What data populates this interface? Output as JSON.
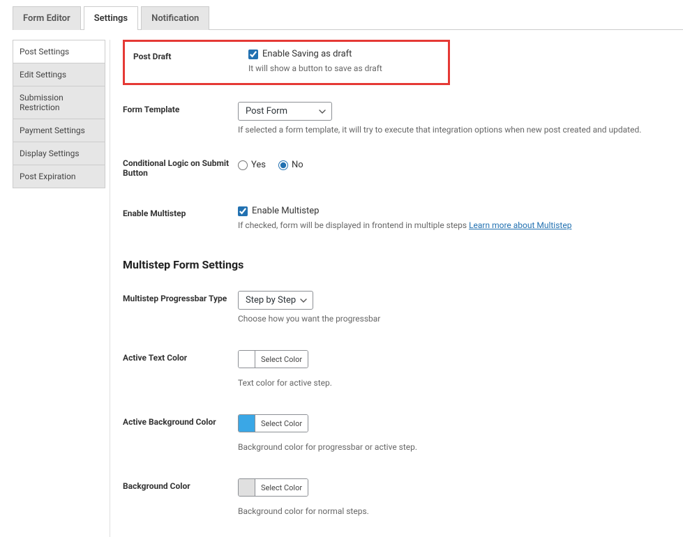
{
  "tabs": {
    "form_editor": "Form Editor",
    "settings": "Settings",
    "notification": "Notification"
  },
  "sidebar": {
    "items": [
      "Post Settings",
      "Edit Settings",
      "Submission Restriction",
      "Payment Settings",
      "Display Settings",
      "Post Expiration"
    ]
  },
  "fields": {
    "post_draft": {
      "label": "Post Draft",
      "chk_label": "Enable Saving as draft",
      "help": "It will show a button to save as draft"
    },
    "form_template": {
      "label": "Form Template",
      "value": "Post Form",
      "help": "If selected a form template, it will try to execute that integration options when new post created and updated."
    },
    "conditional": {
      "label": "Conditional Logic on Submit Button",
      "yes": "Yes",
      "no": "No"
    },
    "multistep": {
      "label": "Enable Multistep",
      "chk_label": "Enable Multistep",
      "help": "If checked, form will be displayed in frontend in multiple steps ",
      "link": "Learn more about Multistep"
    },
    "section_heading": "Multistep Form Settings",
    "progressbar_type": {
      "label": "Multistep Progressbar Type",
      "value": "Step by Step",
      "help": "Choose how you want the progressbar"
    },
    "active_text_color": {
      "label": "Active Text Color",
      "btn": "Select Color",
      "swatch": "#ffffff",
      "help": "Text color for active step."
    },
    "active_bg_color": {
      "label": "Active Background Color",
      "btn": "Select Color",
      "swatch": "#3aa7e6",
      "help": "Background color for progressbar or active step."
    },
    "bg_color": {
      "label": "Background Color",
      "btn": "Select Color",
      "swatch": "#e0e0e0",
      "help": "Background color for normal steps."
    }
  }
}
